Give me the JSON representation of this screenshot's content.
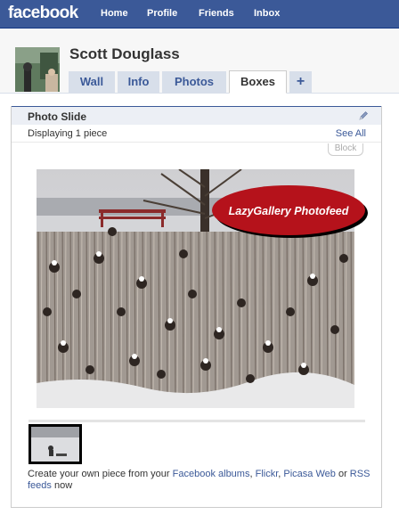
{
  "topbar": {
    "logo": "facebook",
    "nav": [
      "Home",
      "Profile",
      "Friends",
      "Inbox"
    ]
  },
  "profile": {
    "name": "Scott Douglass",
    "tabs": [
      "Wall",
      "Info",
      "Photos",
      "Boxes",
      "+"
    ],
    "active_tab": "Boxes"
  },
  "box": {
    "title": "Photo Slide",
    "status": "Displaying 1 piece",
    "see_all": "See All",
    "block_label": "Block",
    "badge_text": "LazyGallery Photofeed"
  },
  "footer": {
    "prefix": "Create your own piece from your ",
    "link_albums": "Facebook albums",
    "sep1": ", ",
    "link_flickr": "Flickr",
    "sep2": ", ",
    "link_picasa": "Picasa Web",
    "sep3": " or ",
    "link_rss": "RSS feeds",
    "suffix": " now"
  },
  "colors": {
    "brand": "#3b5998",
    "badge_red": "#b5121b"
  }
}
